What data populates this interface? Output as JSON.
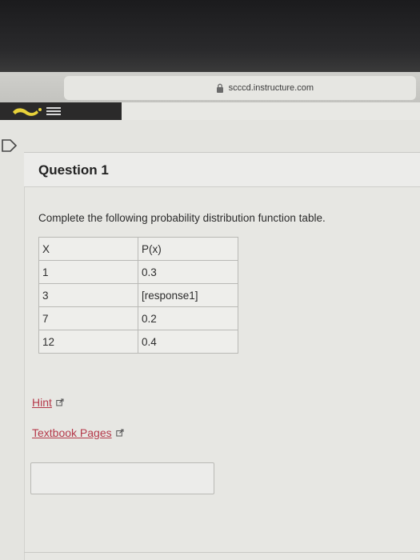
{
  "browser": {
    "url": "scccd.instructure.com"
  },
  "question": {
    "title": "Question 1",
    "prompt": "Complete the following probability distribution function table.",
    "table": {
      "headers": [
        "X",
        "P(x)"
      ],
      "rows": [
        [
          "1",
          "0.3"
        ],
        [
          "3",
          "[response1]"
        ],
        [
          "7",
          "0.2"
        ],
        [
          "12",
          "0.4"
        ]
      ]
    }
  },
  "links": {
    "hint": "Hint",
    "textbook": "Textbook Pages"
  },
  "answer": {
    "value": ""
  },
  "colors": {
    "link": "#b5394a",
    "logo_accent": "#e8d23a"
  },
  "icons": {
    "lock": "lock-icon",
    "external": "external-link-icon",
    "flag": "flag-icon"
  }
}
